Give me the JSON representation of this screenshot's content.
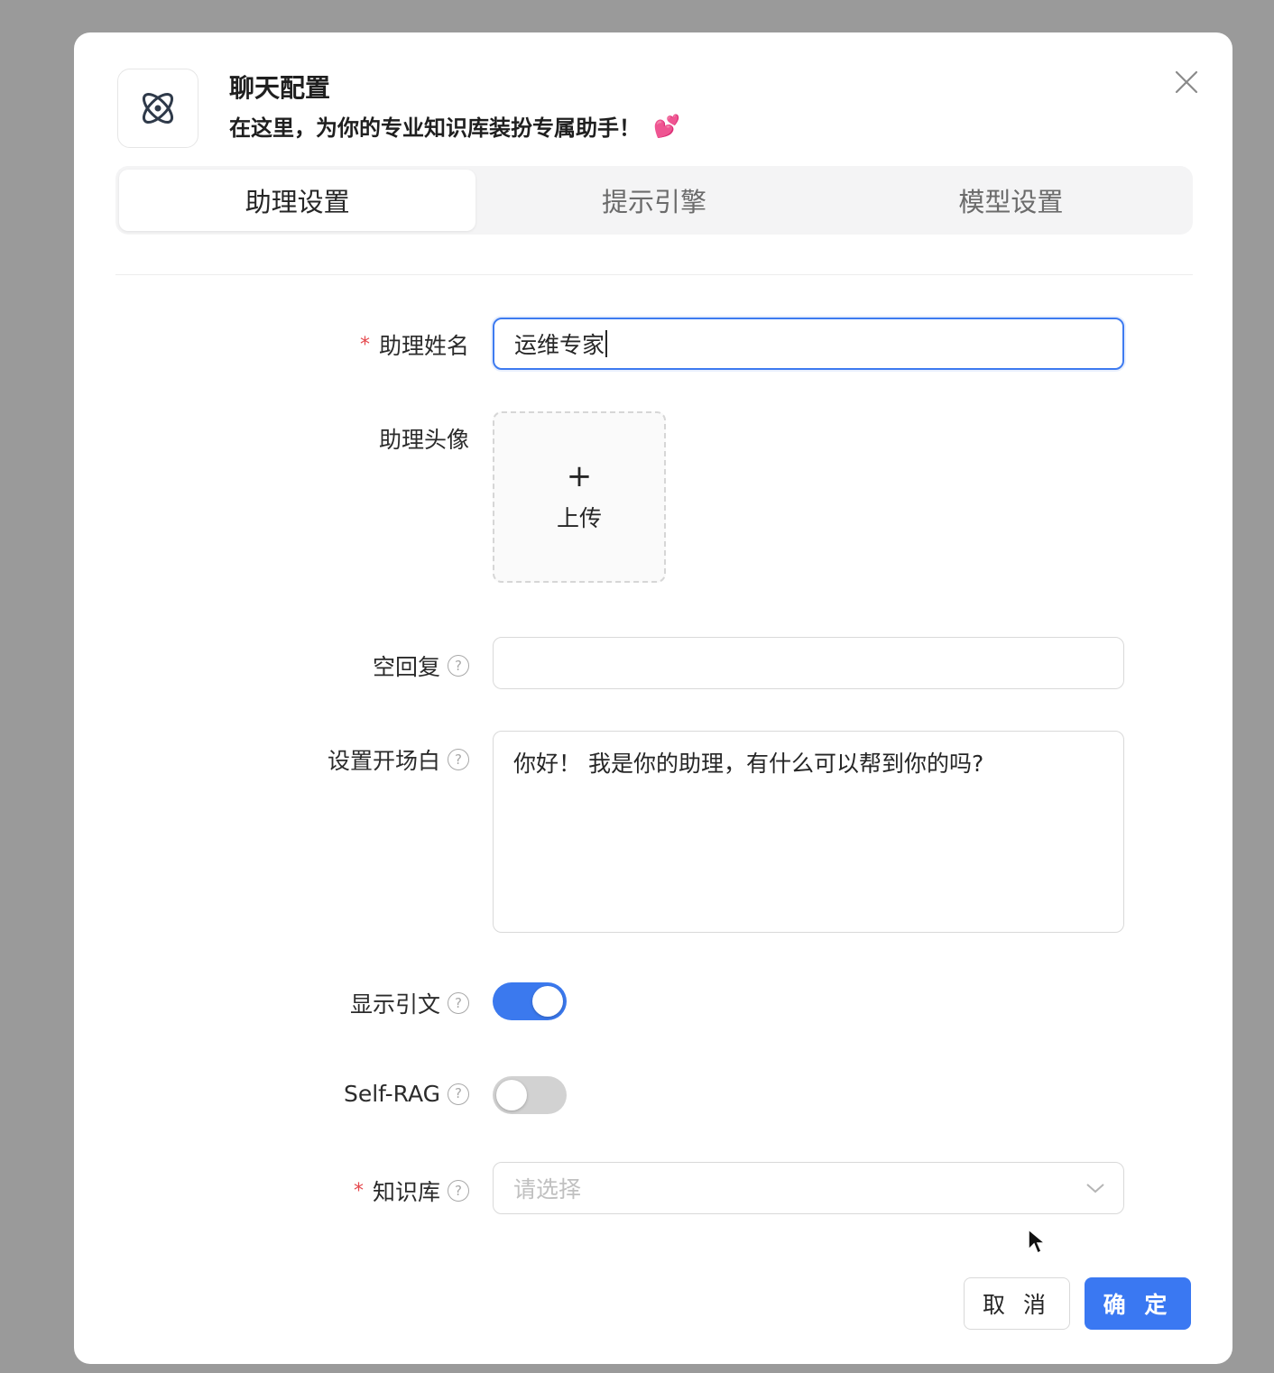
{
  "dialog": {
    "title": "聊天配置",
    "subtitle": "在这里，为你的专业知识库装扮专属助手！",
    "header_icon": "atom-icon",
    "subtitle_emoji": "💕",
    "close_icon": "close-icon"
  },
  "tabs": [
    {
      "label": "助理设置",
      "active": true
    },
    {
      "label": "提示引擎",
      "active": false
    },
    {
      "label": "模型设置",
      "active": false
    }
  ],
  "form": {
    "assistant_name": {
      "label": "助理姓名",
      "required_mark": "*",
      "value": "运维专家"
    },
    "avatar": {
      "label": "助理头像",
      "upload_plus": "+",
      "upload_text": "上传"
    },
    "empty_reply": {
      "label": "空回复",
      "value": ""
    },
    "opening": {
      "label": "设置开场白",
      "value": "你好！ 我是你的助理，有什么可以帮到你的吗?"
    },
    "show_citation": {
      "label": "显示引文",
      "enabled": true
    },
    "self_rag": {
      "label": "Self-RAG",
      "enabled": false
    },
    "knowledge_base": {
      "label": "知识库",
      "required_mark": "*",
      "placeholder": "请选择"
    },
    "help_glyph": "?"
  },
  "footer": {
    "cancel_label": "取 消",
    "confirm_label": "确 定"
  },
  "colors": {
    "primary": "#3a78f2",
    "required": "#e5484d"
  }
}
